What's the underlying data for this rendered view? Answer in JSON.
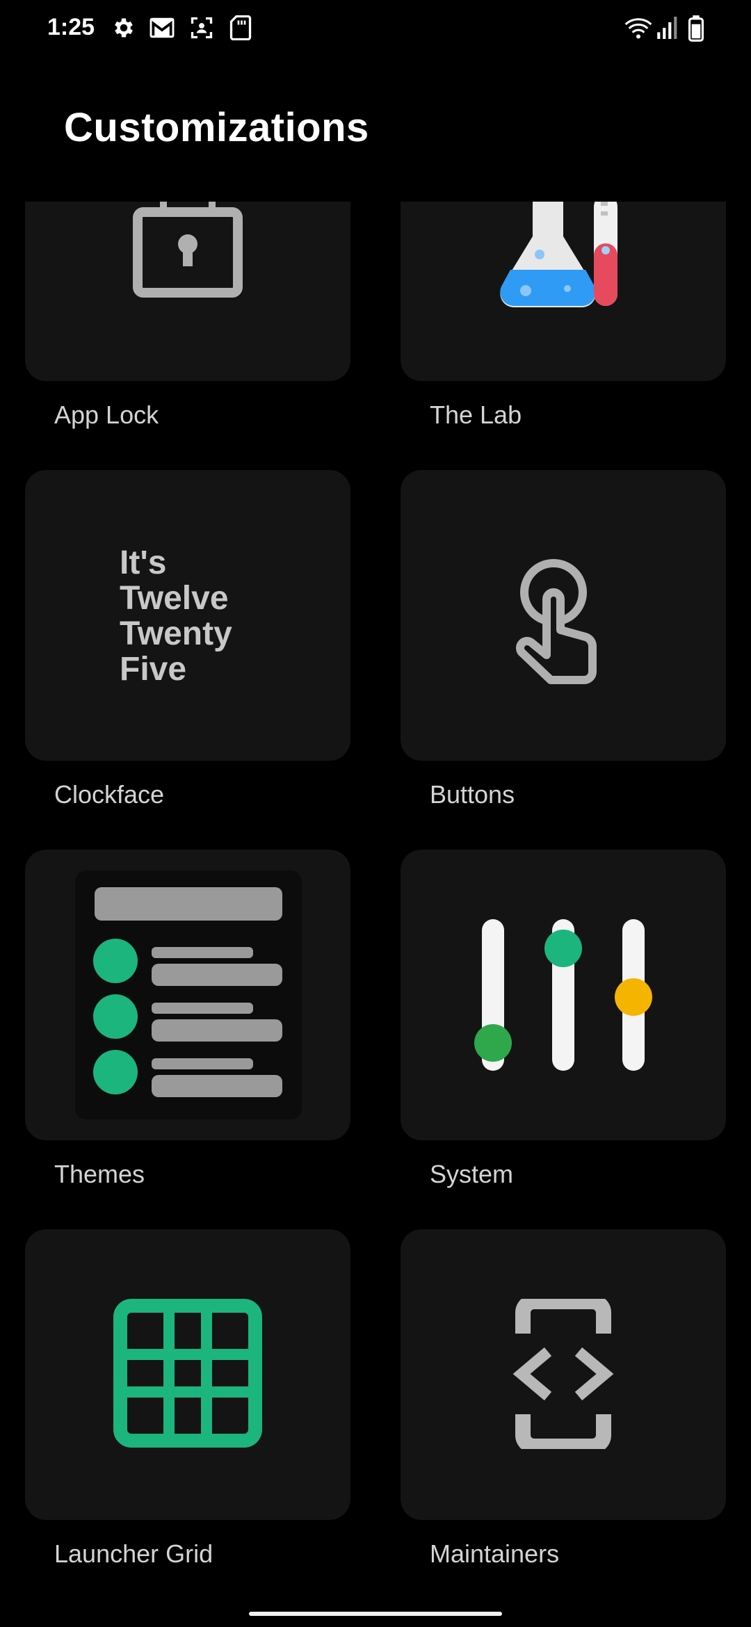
{
  "status_bar": {
    "time": "1:25",
    "icons": [
      "settings-icon",
      "gmail-icon",
      "face-scan-icon",
      "sd-card-icon",
      "wifi-icon",
      "signal-icon",
      "battery-icon"
    ]
  },
  "header": {
    "title": "Customizations"
  },
  "tiles": [
    {
      "label": "App Lock",
      "icon": "lock-icon"
    },
    {
      "label": "The Lab",
      "icon": "lab-flask-icon"
    },
    {
      "label": "Clockface",
      "icon": "clock-text-preview",
      "preview_lines": [
        "It's",
        "Twelve",
        "Twenty",
        "Five"
      ]
    },
    {
      "label": "Buttons",
      "icon": "touch-hand-icon"
    },
    {
      "label": "Themes",
      "icon": "theme-list-icon"
    },
    {
      "label": "System",
      "icon": "sliders-icon"
    },
    {
      "label": "Launcher Grid",
      "icon": "grid-icon"
    },
    {
      "label": "Maintainers",
      "icon": "code-phone-icon"
    }
  ],
  "colors": {
    "background": "#000000",
    "tile": "#141414",
    "accent_green": "#1bb57d",
    "yellow": "#f5b400",
    "dark_green": "#2ea84a",
    "icon_gray": "#b0b0b0"
  }
}
